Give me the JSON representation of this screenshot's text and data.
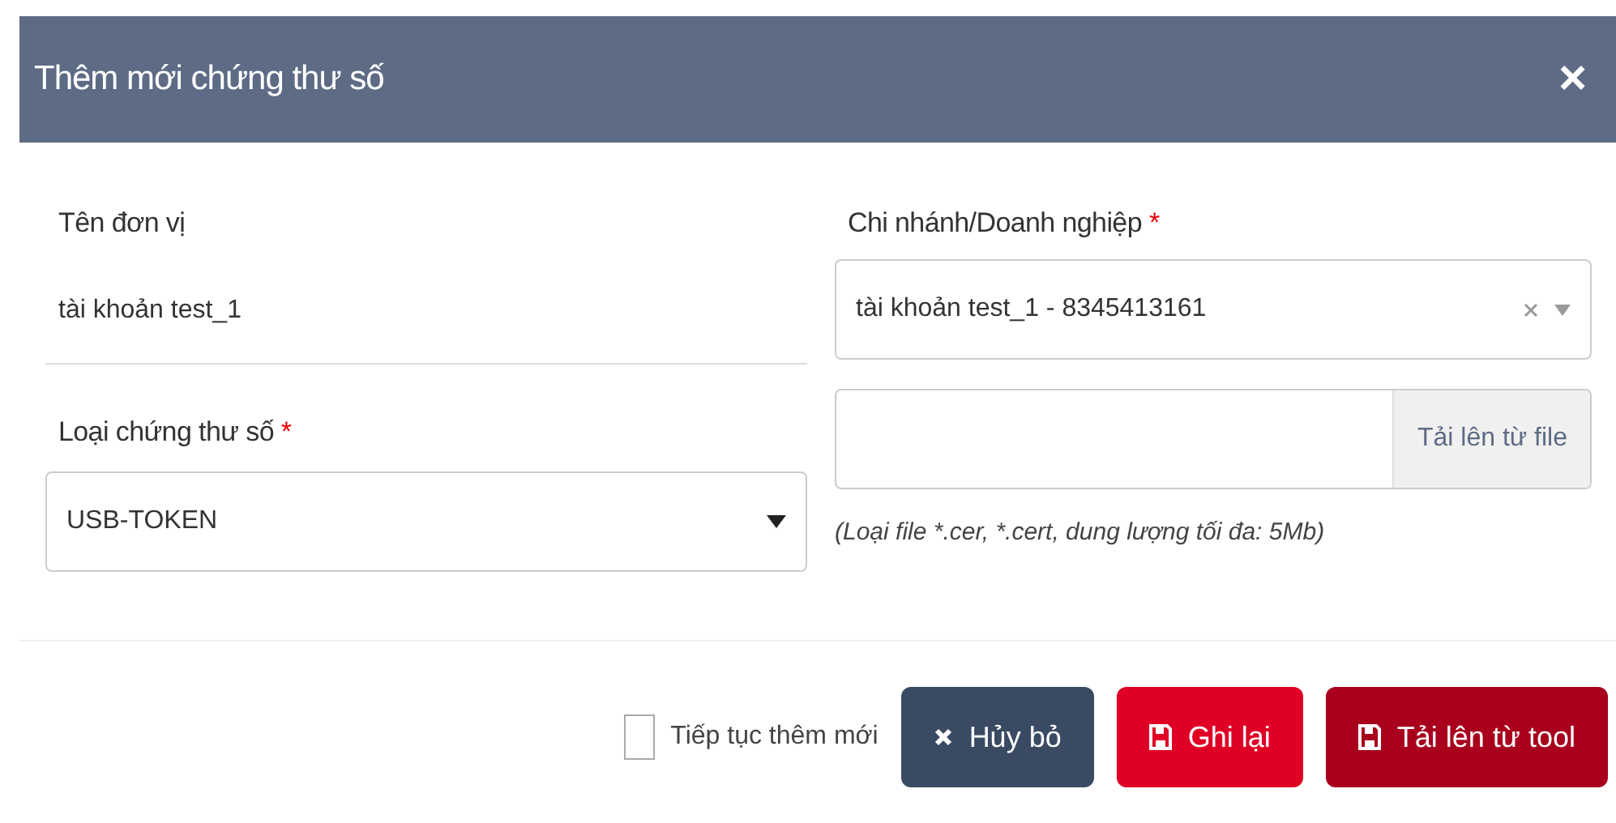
{
  "dialog": {
    "title": "Thêm mới chứng thư số",
    "close": "×"
  },
  "fields": {
    "unit_name": {
      "label": "Tên đơn vị",
      "value": "tài khoản test_1"
    },
    "branch": {
      "label": "Chi nhánh/Doanh nghiệp",
      "required_mark": "*",
      "value": "tài khoản test_1 - 8345413161"
    },
    "cert_type": {
      "label": "Loại chứng thư số",
      "required_mark": "*",
      "value": "USB-TOKEN"
    },
    "file": {
      "button": "Tải lên từ file",
      "hint": "(Loại file *.cer, *.cert, dung lượng tối đa: 5Mb)"
    }
  },
  "footer": {
    "continue": {
      "label": "Tiếp tục thêm mới",
      "checked": false
    },
    "buttons": [
      {
        "kind": "cancel",
        "label": "Hủy bỏ"
      },
      {
        "kind": "save",
        "label": "Ghi lại"
      },
      {
        "kind": "tool",
        "label": "Tải lên từ tool"
      }
    ]
  }
}
